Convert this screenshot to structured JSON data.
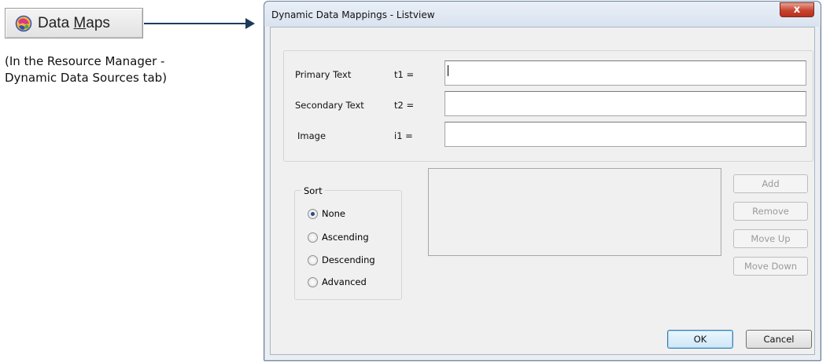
{
  "annotation": {
    "button_label_prefix": "Data ",
    "button_label_mnemonic": "M",
    "button_label_suffix": "aps",
    "icon": "data-maps-icon",
    "caption_line1": "(In the Resource Manager -",
    "caption_line2": "Dynamic Data Sources tab)",
    "arrow_color": "#1d3a5c"
  },
  "dialog": {
    "title": "Dynamic Data Mappings - Listview",
    "close_label": "x",
    "fields": [
      {
        "label": "Primary Text",
        "var": "t1 =",
        "value": ""
      },
      {
        "label": "Secondary Text",
        "var": "t2 =",
        "value": ""
      },
      {
        "label": "Image",
        "var": "i1 =",
        "value": ""
      }
    ],
    "sort": {
      "title": "Sort",
      "options": [
        "None",
        "Ascending",
        "Descending",
        "Advanced"
      ],
      "selected": "None"
    },
    "side_buttons": {
      "add": "Add",
      "remove": "Remove",
      "move_up": "Move Up",
      "move_down": "Move Down"
    },
    "ok_label": "OK",
    "cancel_label": "Cancel"
  }
}
